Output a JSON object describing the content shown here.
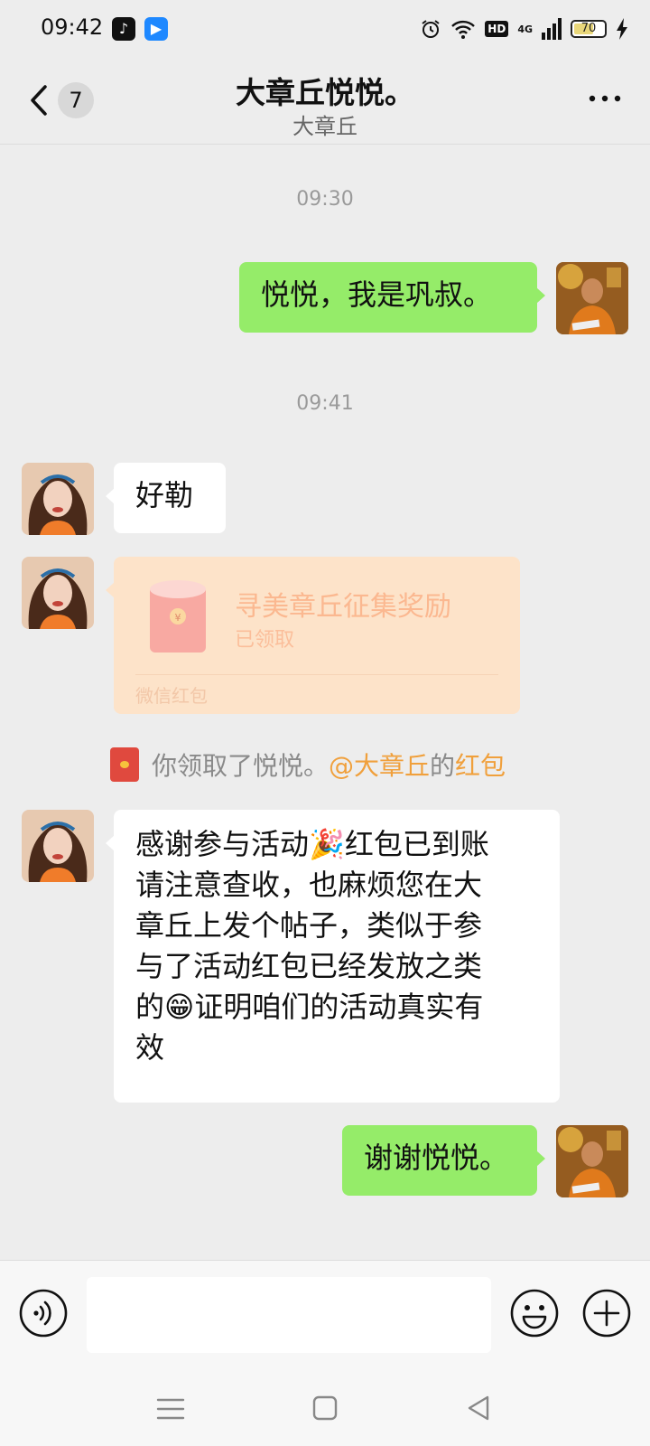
{
  "status_bar": {
    "time": "09:42",
    "hd_label": "HD",
    "network_label": "4G",
    "battery_level": "70",
    "icons": [
      "tiktok-icon",
      "app-icon",
      "alarm-icon",
      "wifi-icon",
      "hd-icon",
      "signal-icon",
      "battery-icon",
      "charging-icon"
    ]
  },
  "header": {
    "back_count": "7",
    "title": "大章丘悦悦。",
    "subtitle": "大章丘"
  },
  "messages": {
    "ts1": "09:30",
    "m1": "悦悦，我是巩叔。",
    "ts2": "09:41",
    "m2": "好勒",
    "m3_line1": "感谢参与活动🎉红包已到账",
    "m3_line2": "请注意查收，也麻烦您在大",
    "m3_line3": "章丘上发个帖子，类似于参",
    "m3_line4": "与了活动红包已经发放之类",
    "m3_line5": "的😁证明咱们的活动真实有",
    "m3_line6": "效",
    "m4": "谢谢悦悦。"
  },
  "red_packet": {
    "title": "寻美章丘征集奖励",
    "status": "已领取",
    "brand": "微信红包"
  },
  "system_message": {
    "prefix": "你领取了悦悦。",
    "mention": "@大章丘",
    "middle": "的",
    "link": "红包"
  },
  "input": {
    "value": "",
    "placeholder": ""
  },
  "colors": {
    "background": "#ededed",
    "outgoing_bubble": "#95ec69",
    "incoming_bubble": "#ffffff",
    "red_packet_opened": "#fde3c9",
    "accent_orange": "#f0a03c"
  }
}
